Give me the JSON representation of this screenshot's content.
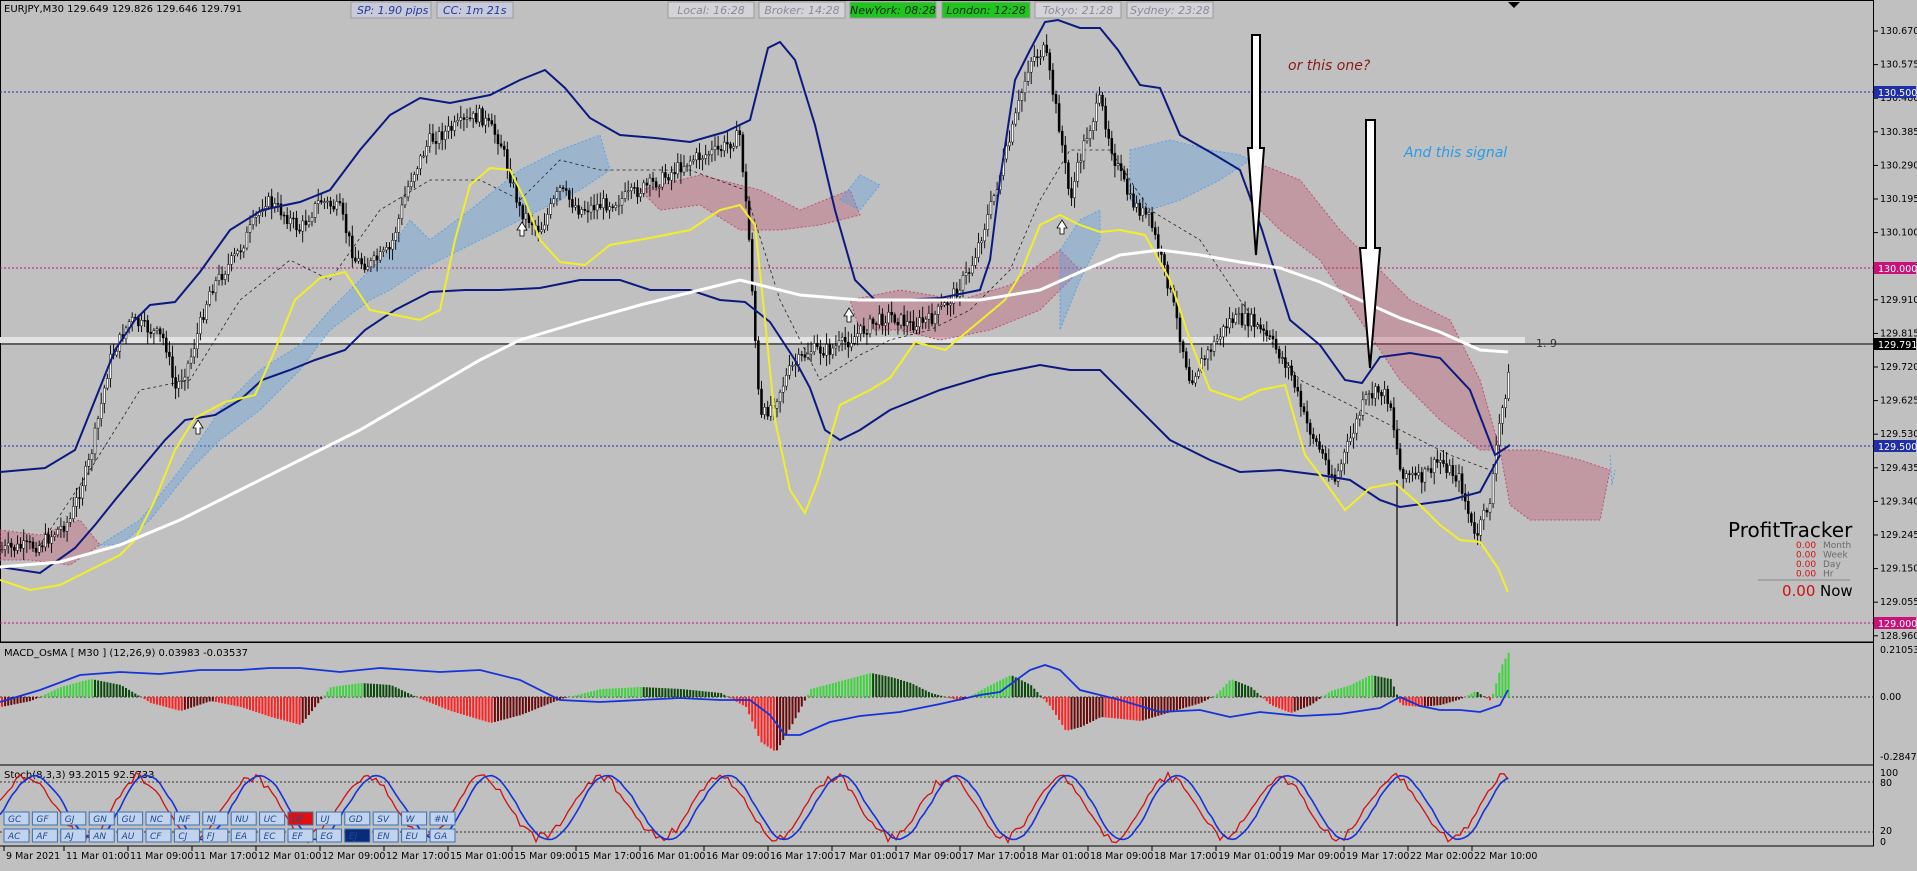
{
  "symbol_line": "EURJPY,M30  129.649 129.826 129.646 129.791",
  "top_stats": [
    {
      "label": "SP: 1.90 pips"
    },
    {
      "label": "CC: 1m 21s"
    }
  ],
  "sessions": [
    {
      "label": "Local: 16:28",
      "active": false
    },
    {
      "label": "Broker: 14:28",
      "active": false
    },
    {
      "label": "NewYork: 08:28",
      "active": true
    },
    {
      "label": "London: 12:28",
      "active": true
    },
    {
      "label": "Tokyo: 21:28",
      "active": false
    },
    {
      "label": "Sydney: 23:28",
      "active": false
    }
  ],
  "annotations": {
    "one": "or this one?",
    "two": "And this signal",
    "fib": "1. 9"
  },
  "price_axis": [
    "130.670",
    "130.575",
    "130.480",
    "130.385",
    "130.290",
    "130.195",
    "130.100",
    "130.005",
    "129.910",
    "129.815",
    "129.720",
    "129.625",
    "129.530",
    "129.435",
    "129.340",
    "129.245",
    "129.150",
    "129.055",
    "128.960"
  ],
  "price_tags": [
    {
      "label": "130.500",
      "color": "#1e2fa8"
    },
    {
      "label": "130.000",
      "color": "#c8127a"
    },
    {
      "label": "129.791",
      "color": "#000000"
    },
    {
      "label": "129.500",
      "color": "#1e2fa8"
    },
    {
      "label": "129.000",
      "color": "#c8127a"
    }
  ],
  "profit": {
    "title": "ProfitTracker",
    "rows": [
      {
        "value": "0.00",
        "label": "Month"
      },
      {
        "value": "0.00",
        "label": "Week"
      },
      {
        "value": "0.00",
        "label": "Day"
      },
      {
        "value": "0.00",
        "label": "Hr"
      }
    ],
    "now_value": "0.00",
    "now_label": "Now"
  },
  "macd": {
    "label": "MACD_OsMA [ M30 ] (12,26,9)  0.03983 -0.03537",
    "axis": [
      "0.21053",
      "0.00",
      "-0.2847"
    ]
  },
  "stoch": {
    "label": "Stoch(8,3,3) 93.2015 92.5733",
    "axis": [
      "100",
      "80",
      "20",
      "0"
    ]
  },
  "x_axis": [
    "9 Mar 2021",
    "11 Mar 01:00",
    "11 Mar 09:00",
    "11 Mar 17:00",
    "12 Mar 01:00",
    "12 Mar 09:00",
    "12 Mar 17:00",
    "15 Mar 01:00",
    "15 Mar 09:00",
    "15 Mar 17:00",
    "16 Mar 01:00",
    "16 Mar 09:00",
    "16 Mar 17:00",
    "17 Mar 01:00",
    "17 Mar 09:00",
    "17 Mar 17:00",
    "18 Mar 01:00",
    "18 Mar 09:00",
    "18 Mar 17:00",
    "19 Mar 01:00",
    "19 Mar 09:00",
    "19 Mar 17:00",
    "22 Mar 02:00",
    "22 Mar 10:00"
  ],
  "pair_buttons_row1": [
    "GC",
    "GF",
    "GJ",
    "GN",
    "GU",
    "NC",
    "NF",
    "NJ",
    "NU",
    "UC",
    "UF",
    "UJ",
    "GD",
    "SV",
    "W",
    "#N"
  ],
  "pair_buttons_row2": [
    "AC",
    "AF",
    "AJ",
    "AN",
    "AU",
    "CF",
    "CJ",
    "FJ",
    "EA",
    "EC",
    "EF",
    "EG",
    "EJ",
    "EN",
    "EU",
    "GA"
  ],
  "colors": {
    "active_session": "#1fc41f",
    "highlight_button": "#e01010",
    "selected_button": "#0a2a7a",
    "bands": "#0c1a80",
    "signal_line": "#f2ee2a",
    "ma_line": "#ffffff"
  }
}
